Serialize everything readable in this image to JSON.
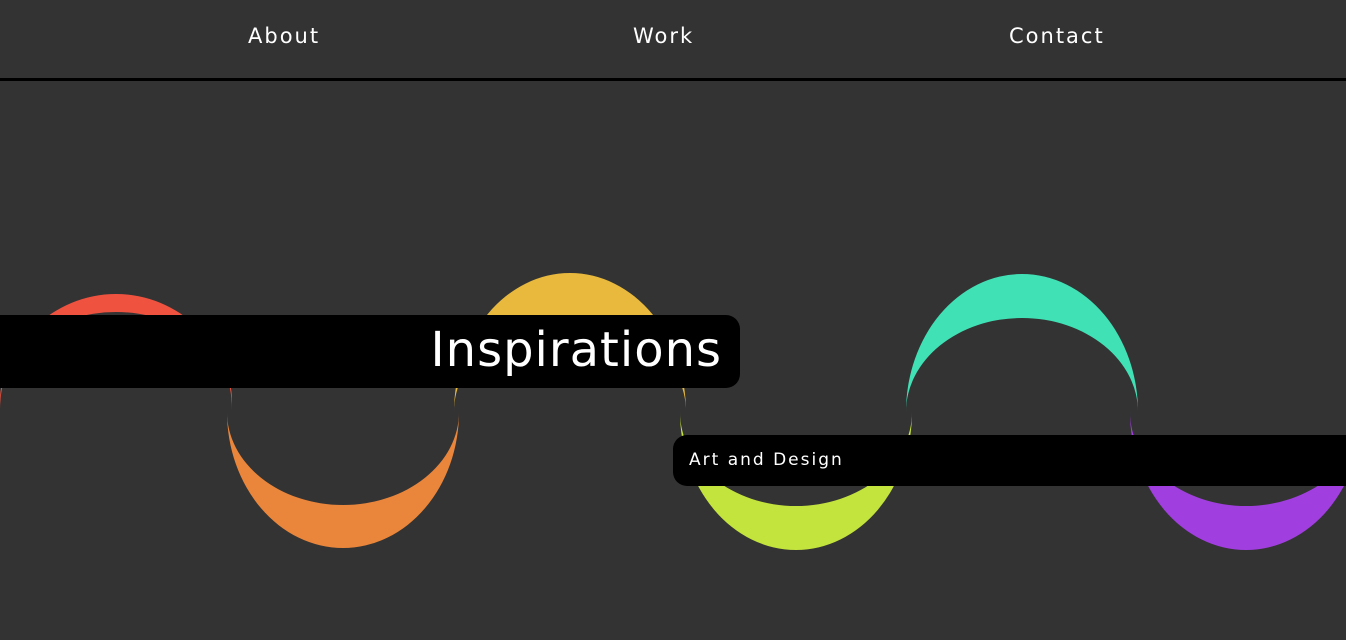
{
  "nav": {
    "about_label": "About",
    "work_label": "Work",
    "contact_label": "Contact"
  },
  "hero": {
    "title": "Inspirations",
    "subtitle": "Art and Design"
  },
  "colors": {
    "background": "#333333",
    "ring_red": "#f05240",
    "ring_orange": "#ea863b",
    "ring_yellow": "#e8b93c",
    "ring_lime": "#c3e33d",
    "ring_teal": "#41e1b6",
    "ring_purple": "#a13ee0",
    "banner": "#000000",
    "text": "#ffffff"
  }
}
